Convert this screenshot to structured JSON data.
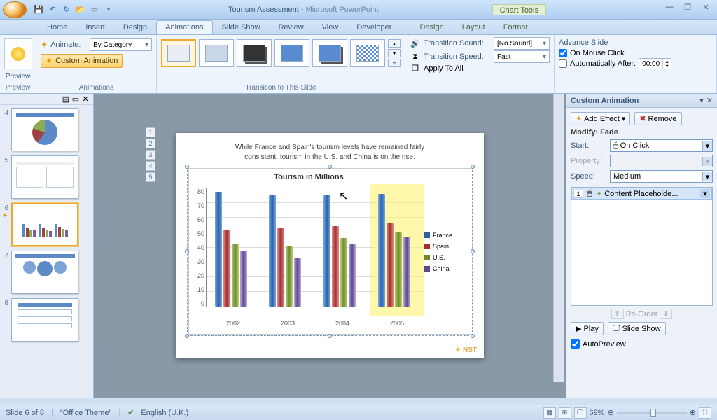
{
  "title": {
    "doc": "Tourism Assessment",
    "app": "Microsoft PowerPoint",
    "context": "Chart Tools"
  },
  "tabs": [
    "Home",
    "Insert",
    "Design",
    "Animations",
    "Slide Show",
    "Review",
    "View",
    "Developer"
  ],
  "ctx_tabs": [
    "Design",
    "Layout",
    "Format"
  ],
  "groups": {
    "preview": "Preview",
    "preview_btn": "Preview",
    "animations": "Animations",
    "transition": "Transition to This Slide"
  },
  "anim": {
    "animate_lbl": "Animate:",
    "animate_val": "By Category",
    "custom_btn": "Custom Animation"
  },
  "trans": {
    "sound_lbl": "Transition Sound:",
    "sound_val": "[No Sound]",
    "speed_lbl": "Transition Speed:",
    "speed_val": "Fast",
    "apply": "Apply To All",
    "adv_title": "Advance Slide",
    "on_click": "On Mouse Click",
    "auto_after": "Automatically After:",
    "auto_time": "00:00"
  },
  "pane": {
    "title": "Custom Animation",
    "add": "Add Effect",
    "remove": "Remove",
    "modify": "Modify: Fade",
    "start_lbl": "Start:",
    "start_val": "On Click",
    "prop_lbl": "Property:",
    "speed_lbl": "Speed:",
    "speed_val": "Medium",
    "item_num": "1",
    "item_txt": "Content Placeholde...",
    "reorder": "Re-Order",
    "play": "Play",
    "show": "Slide Show",
    "autoprev": "AutoPreview"
  },
  "slide": {
    "caption1": "While France and Spain's tourism levels have remained fairly",
    "caption2": "consistent, tourism in the U.S. and China is on the rise.",
    "brand": "NST"
  },
  "chart_data": {
    "type": "bar",
    "title": "Tourism in Millions",
    "categories": [
      "2002",
      "2003",
      "2004",
      "2005"
    ],
    "series": [
      {
        "name": "France",
        "values": [
          77,
          75,
          75,
          76
        ]
      },
      {
        "name": "Spain",
        "values": [
          52,
          53,
          54,
          56
        ]
      },
      {
        "name": "U.S.",
        "values": [
          42,
          41,
          46,
          50
        ]
      },
      {
        "name": "China",
        "values": [
          37,
          33,
          42,
          47
        ]
      }
    ],
    "ylim": [
      0,
      80
    ],
    "yticks": [
      0,
      10,
      20,
      30,
      40,
      50,
      60,
      70,
      80
    ]
  },
  "thumbs": {
    "visible": [
      4,
      5,
      6,
      7,
      8
    ],
    "selected": 6
  },
  "status": {
    "slide": "Slide 6 of 8",
    "theme": "\"Office Theme\"",
    "lang": "English (U.K.)",
    "zoom": "69%"
  }
}
